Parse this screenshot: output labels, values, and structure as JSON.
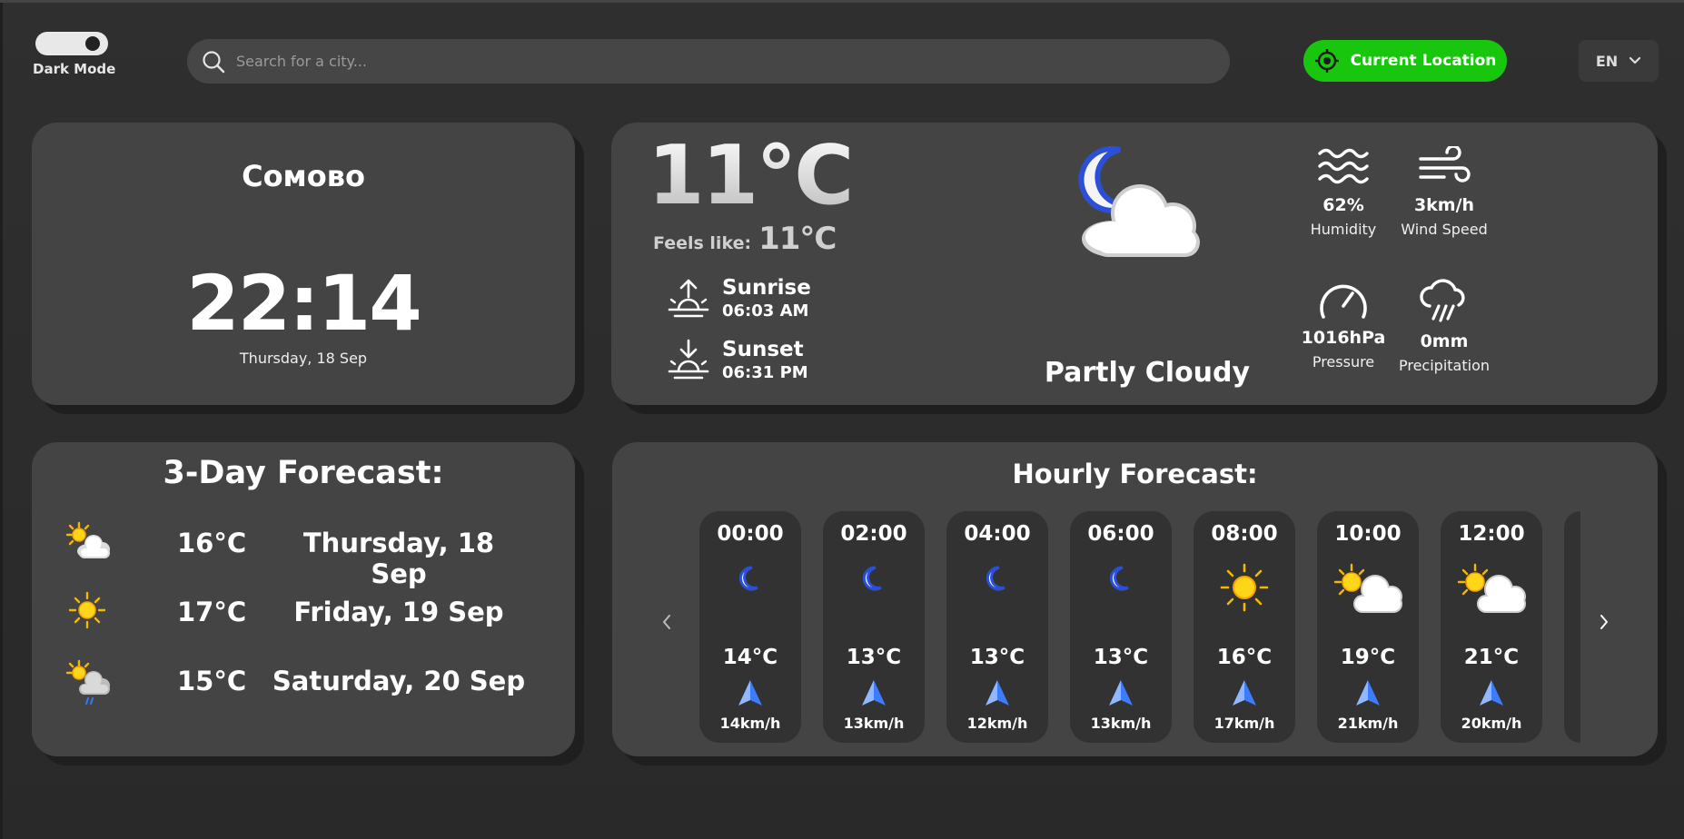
{
  "header": {
    "dark_mode_label": "Dark Mode",
    "search_placeholder": "Search for a city...",
    "location_button": "Current Location",
    "language": "EN"
  },
  "city": {
    "name": "Сомово",
    "time": "22:14",
    "date": "Thursday, 18 Sep"
  },
  "current": {
    "temperature": "11°C",
    "feels_like_label": "Feels like:",
    "feels_like_value": "11°C",
    "sunrise_label": "Sunrise",
    "sunrise_time": "06:03 AM",
    "sunset_label": "Sunset",
    "sunset_time": "06:31 PM",
    "condition": "Partly Cloudy",
    "condition_icon": "moon-cloud-icon",
    "stats": {
      "humidity_value": "62%",
      "humidity_label": "Humidity",
      "wind_value": "3km/h",
      "wind_label": "Wind Speed",
      "pressure_value": "1016hPa",
      "pressure_label": "Pressure",
      "precip_value": "0mm",
      "precip_label": "Precipitation"
    }
  },
  "forecast": {
    "title": "3-Day Forecast:",
    "days": [
      {
        "icon": "sun-cloud-icon",
        "temp": "16°C",
        "date": "Thursday, 18 Sep"
      },
      {
        "icon": "sun-icon",
        "temp": "17°C",
        "date": "Friday, 19 Sep"
      },
      {
        "icon": "sun-cloud-rain-icon",
        "temp": "15°C",
        "date": "Saturday, 20 Sep"
      }
    ]
  },
  "hourly": {
    "title": "Hourly Forecast:",
    "hours": [
      {
        "time": "00:00",
        "icon": "moon-icon",
        "temp": "14°C",
        "wind": "14km/h"
      },
      {
        "time": "02:00",
        "icon": "moon-icon",
        "temp": "13°C",
        "wind": "13km/h"
      },
      {
        "time": "04:00",
        "icon": "moon-icon",
        "temp": "13°C",
        "wind": "12km/h"
      },
      {
        "time": "06:00",
        "icon": "moon-icon",
        "temp": "13°C",
        "wind": "13km/h"
      },
      {
        "time": "08:00",
        "icon": "sun-icon",
        "temp": "16°C",
        "wind": "17km/h"
      },
      {
        "time": "10:00",
        "icon": "sun-cloud-icon",
        "temp": "19°C",
        "wind": "21km/h"
      },
      {
        "time": "12:00",
        "icon": "sun-cloud-icon",
        "temp": "21°C",
        "wind": "20km/h"
      }
    ]
  },
  "colors": {
    "accent_green": "#19c60e",
    "card_bg": "#444444",
    "page_bg": "#2d2d2d"
  }
}
